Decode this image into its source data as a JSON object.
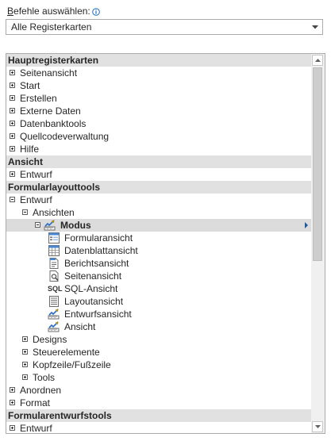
{
  "label": {
    "prefix": "B",
    "rest": "efehle auswählen:"
  },
  "dropdown": {
    "value": "Alle Registerkarten"
  },
  "tree": [
    {
      "type": "header",
      "text": "Hauptregisterkarten"
    },
    {
      "type": "item",
      "level": 0,
      "exp": "plus",
      "text": "Seitenansicht"
    },
    {
      "type": "item",
      "level": 0,
      "exp": "plus",
      "text": "Start"
    },
    {
      "type": "item",
      "level": 0,
      "exp": "plus",
      "text": "Erstellen"
    },
    {
      "type": "item",
      "level": 0,
      "exp": "plus",
      "text": "Externe Daten"
    },
    {
      "type": "item",
      "level": 0,
      "exp": "plus",
      "text": "Datenbanktools"
    },
    {
      "type": "item",
      "level": 0,
      "exp": "plus",
      "text": "Quellcodeverwaltung"
    },
    {
      "type": "item",
      "level": 0,
      "exp": "plus",
      "text": "Hilfe"
    },
    {
      "type": "header",
      "text": "Ansicht"
    },
    {
      "type": "item",
      "level": 0,
      "exp": "plus",
      "text": "Entwurf"
    },
    {
      "type": "header",
      "text": "Formularlayouttools"
    },
    {
      "type": "item",
      "level": 0,
      "exp": "minus",
      "text": "Entwurf"
    },
    {
      "type": "item",
      "level": 1,
      "exp": "minus",
      "text": "Ansichten"
    },
    {
      "type": "item",
      "level": 2,
      "exp": "minus",
      "icon": "design-view-icon",
      "text": "Modus",
      "selected": true,
      "bold": true
    },
    {
      "type": "item",
      "level": 3,
      "icon": "form-view-icon",
      "text": "Formularansicht"
    },
    {
      "type": "item",
      "level": 3,
      "icon": "datasheet-view-icon",
      "text": "Datenblattansicht"
    },
    {
      "type": "item",
      "level": 3,
      "icon": "report-view-icon",
      "text": "Berichtsansicht"
    },
    {
      "type": "item",
      "level": 3,
      "icon": "print-preview-icon",
      "text": "Seitenansicht"
    },
    {
      "type": "item",
      "level": 3,
      "icon": "sql-icon",
      "iconText": "SQL",
      "text": "SQL-Ansicht"
    },
    {
      "type": "item",
      "level": 3,
      "icon": "layout-view-icon",
      "text": "Layoutansicht"
    },
    {
      "type": "item",
      "level": 3,
      "icon": "design-view-icon",
      "text": "Entwurfsansicht"
    },
    {
      "type": "item",
      "level": 3,
      "icon": "view-icon",
      "text": "Ansicht"
    },
    {
      "type": "item",
      "level": 1,
      "exp": "plus",
      "text": "Designs"
    },
    {
      "type": "item",
      "level": 1,
      "exp": "plus",
      "text": "Steuerelemente"
    },
    {
      "type": "item",
      "level": 1,
      "exp": "plus",
      "text": "Kopfzeile/Fußzeile"
    },
    {
      "type": "item",
      "level": 1,
      "exp": "plus",
      "text": "Tools"
    },
    {
      "type": "item",
      "level": 0,
      "exp": "plus",
      "text": "Anordnen"
    },
    {
      "type": "item",
      "level": 0,
      "exp": "plus",
      "text": "Format"
    },
    {
      "type": "header",
      "text": "Formularentwurfstools"
    },
    {
      "type": "item",
      "level": 0,
      "exp": "plus",
      "text": "Entwurf"
    }
  ]
}
